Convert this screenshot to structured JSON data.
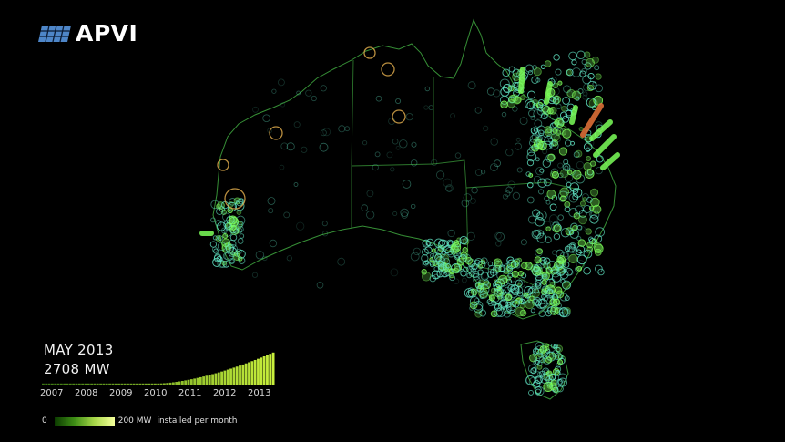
{
  "logo": {
    "text": "APVI"
  },
  "status": {
    "date": "MAY 2013",
    "capacity": "2708 MW"
  },
  "timeline": {
    "years": [
      "2007",
      "2008",
      "2009",
      "2010",
      "2011",
      "2012",
      "2013"
    ]
  },
  "legend": {
    "min": "0",
    "max": "200 MW",
    "unit": "installed per month"
  },
  "colors": {
    "background": "#000000",
    "boundary": "#3fa83f",
    "marker_ring": "#5fe0c0",
    "marker_bright": "#7cff5a",
    "marker_old": "#d9a74a",
    "column_high": "#e8753a"
  }
}
